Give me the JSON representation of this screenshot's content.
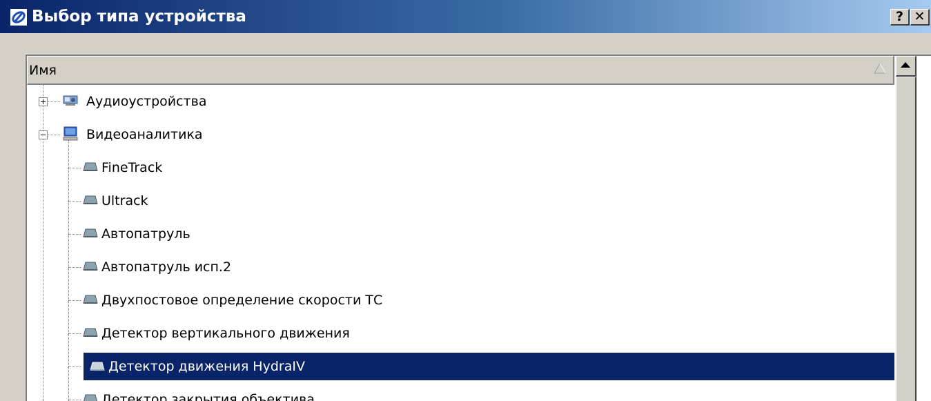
{
  "window": {
    "title": "Выбор типа устройства",
    "help_button": "?",
    "close_button": "✕",
    "title_gradient": [
      "#0a246a",
      "#3a6ea5",
      "#a6caf0"
    ]
  },
  "list": {
    "column_header": "Имя",
    "sort_icon": "sort-ascending-icon",
    "selection_color": "#0a246a"
  },
  "tree": {
    "groups": [
      {
        "label": "Аудиоустройства",
        "expanded": false,
        "icon": "audio-device-icon"
      },
      {
        "label": "Видеоаналитика",
        "expanded": true,
        "icon": "computer-icon"
      }
    ],
    "children": [
      {
        "label": "FineTrack",
        "icon": "module-icon"
      },
      {
        "label": "Ultrack",
        "icon": "module-icon"
      },
      {
        "label": "Автопатруль",
        "icon": "module-icon"
      },
      {
        "label": "Автопатруль исп.2",
        "icon": "module-icon"
      },
      {
        "label": "Двухпостовое определение скорости ТС",
        "icon": "module-icon"
      },
      {
        "label": "Детектор вертикального движения",
        "icon": "module-icon"
      },
      {
        "label": "Детектор движения HydraIV",
        "icon": "module-icon",
        "selected": true
      },
      {
        "label": "Детектор закрытия объектива",
        "icon": "module-icon"
      }
    ]
  }
}
